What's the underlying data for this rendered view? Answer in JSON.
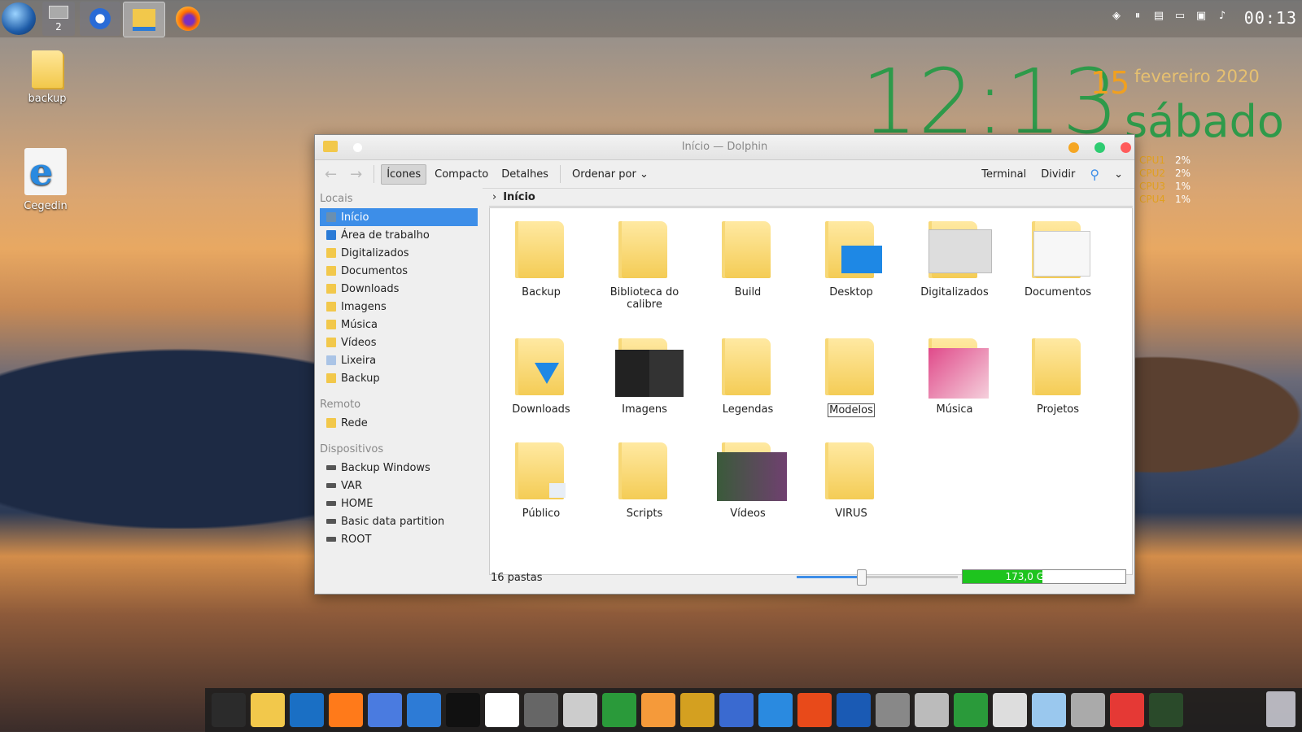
{
  "desktop": {
    "icons": [
      {
        "label": "backup",
        "icon": "folder-icon"
      },
      {
        "label": "Cegedin",
        "icon": "internet-explorer-icon"
      }
    ],
    "clock_widget": {
      "time": "12:13",
      "day": "15",
      "month_year": "fevereiro 2020",
      "weekday": "sábado"
    },
    "cpu": [
      {
        "name": "CPU1",
        "value": "2%"
      },
      {
        "name": "CPU2",
        "value": "2%"
      },
      {
        "name": "CPU3",
        "value": "1%"
      },
      {
        "name": "CPU4",
        "value": "1%"
      }
    ]
  },
  "top_panel": {
    "workspace_number": "2",
    "clock": "00:13",
    "tasks": [
      "chromium-icon",
      "file-manager-icon",
      "firefox-icon"
    ],
    "tray_icons": [
      "shield-icon",
      "pause-icon",
      "clipboard-icon",
      "display-icon",
      "network-icon",
      "volume-icon"
    ]
  },
  "window": {
    "title": "Início — Dolphin",
    "toolbar": {
      "icons": "Ícones",
      "compact": "Compacto",
      "details": "Detalhes",
      "sort": "Ordenar por",
      "terminal": "Terminal",
      "split": "Dividir"
    },
    "sidebar": {
      "places_header": "Locais",
      "places": [
        {
          "label": "Início",
          "icon": "home-icon",
          "selected": true
        },
        {
          "label": "Área de trabalho",
          "icon": "desktop-icon"
        },
        {
          "label": "Digitalizados",
          "icon": "folder-icon"
        },
        {
          "label": "Documentos",
          "icon": "folder-icon"
        },
        {
          "label": "Downloads",
          "icon": "folder-icon"
        },
        {
          "label": "Imagens",
          "icon": "folder-icon"
        },
        {
          "label": "Música",
          "icon": "folder-icon"
        },
        {
          "label": "Vídeos",
          "icon": "folder-icon"
        },
        {
          "label": "Lixeira",
          "icon": "trash-icon"
        },
        {
          "label": "Backup",
          "icon": "folder-icon"
        }
      ],
      "remote_header": "Remoto",
      "remote": [
        {
          "label": "Rede",
          "icon": "network-folder-icon"
        }
      ],
      "devices_header": "Dispositivos",
      "devices": [
        {
          "label": "Backup Windows",
          "icon": "drive-icon"
        },
        {
          "label": "VAR",
          "icon": "drive-icon"
        },
        {
          "label": "HOME",
          "icon": "drive-icon"
        },
        {
          "label": "Basic data partition",
          "icon": "drive-icon"
        },
        {
          "label": "ROOT",
          "icon": "drive-icon"
        }
      ]
    },
    "breadcrumb": "Início",
    "files": [
      "Backup",
      "Biblioteca do calibre",
      "Build",
      "Desktop",
      "Digitalizados",
      "Documentos",
      "Downloads",
      "Imagens",
      "Legendas",
      "Modelos",
      "Música",
      "Projetos",
      "Público",
      "Scripts",
      "Vídeos",
      "VIRUS"
    ],
    "status": {
      "count": "16 pastas",
      "free_space": "173,0 GiB livres",
      "zoom_fraction": 0.4,
      "free_fraction": 0.49
    }
  },
  "dock": {
    "icons": [
      "terminal-icon",
      "file-manager-icon",
      "outlook-icon",
      "firefox-icon",
      "chromium-icon",
      "qbittorrent-icon",
      "netflix-icon",
      "telecine-icon",
      "gimp-icon",
      "inkscape-icon",
      "color-picker-icon",
      "peach-icon",
      "radio-icon",
      "media-icon",
      "browser-icon",
      "office-icon",
      "hp-icon",
      "vm-icon",
      "calculator-icon",
      "equalizer-icon",
      "scanner-icon",
      "id-card-icon",
      "search-icon",
      "screen-recorder-icon",
      "globe-icon"
    ]
  },
  "colors": {
    "accent": "#3d8ee8",
    "clock_green": "#2e9a4a",
    "date_orange": "#f0a020",
    "free_bar": "#1ec41e"
  }
}
